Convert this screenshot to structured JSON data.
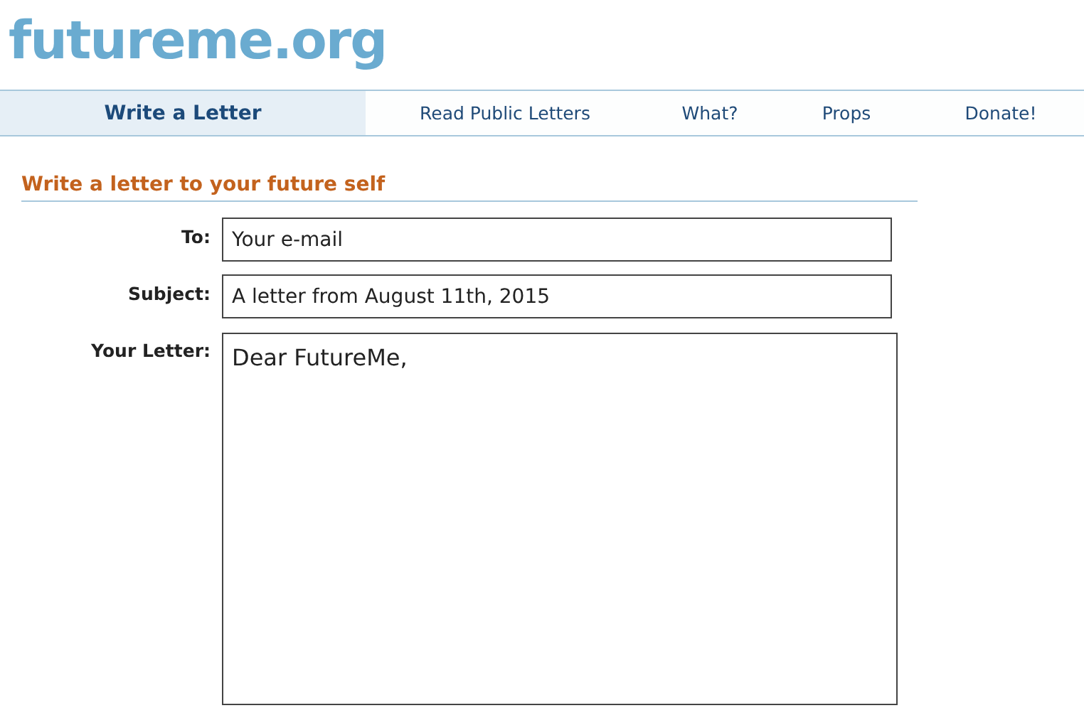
{
  "logo": {
    "text": "futureme.org"
  },
  "nav": [
    {
      "label": "Write a Letter",
      "selected": true
    },
    {
      "label": "Read Public Letters",
      "selected": false
    },
    {
      "label": "What?",
      "selected": false
    },
    {
      "label": "Props",
      "selected": false
    },
    {
      "label": "Donate!",
      "selected": false
    }
  ],
  "form": {
    "heading": "Write a letter to your future self",
    "fields": [
      {
        "kind": "input",
        "label": "To:",
        "value": "Your e-mail"
      },
      {
        "kind": "input",
        "label": "Subject:",
        "value": "A letter from August 11th, 2015"
      },
      {
        "kind": "textarea",
        "label": "Your Letter:",
        "value": "Dear FutureMe,"
      }
    ]
  }
}
